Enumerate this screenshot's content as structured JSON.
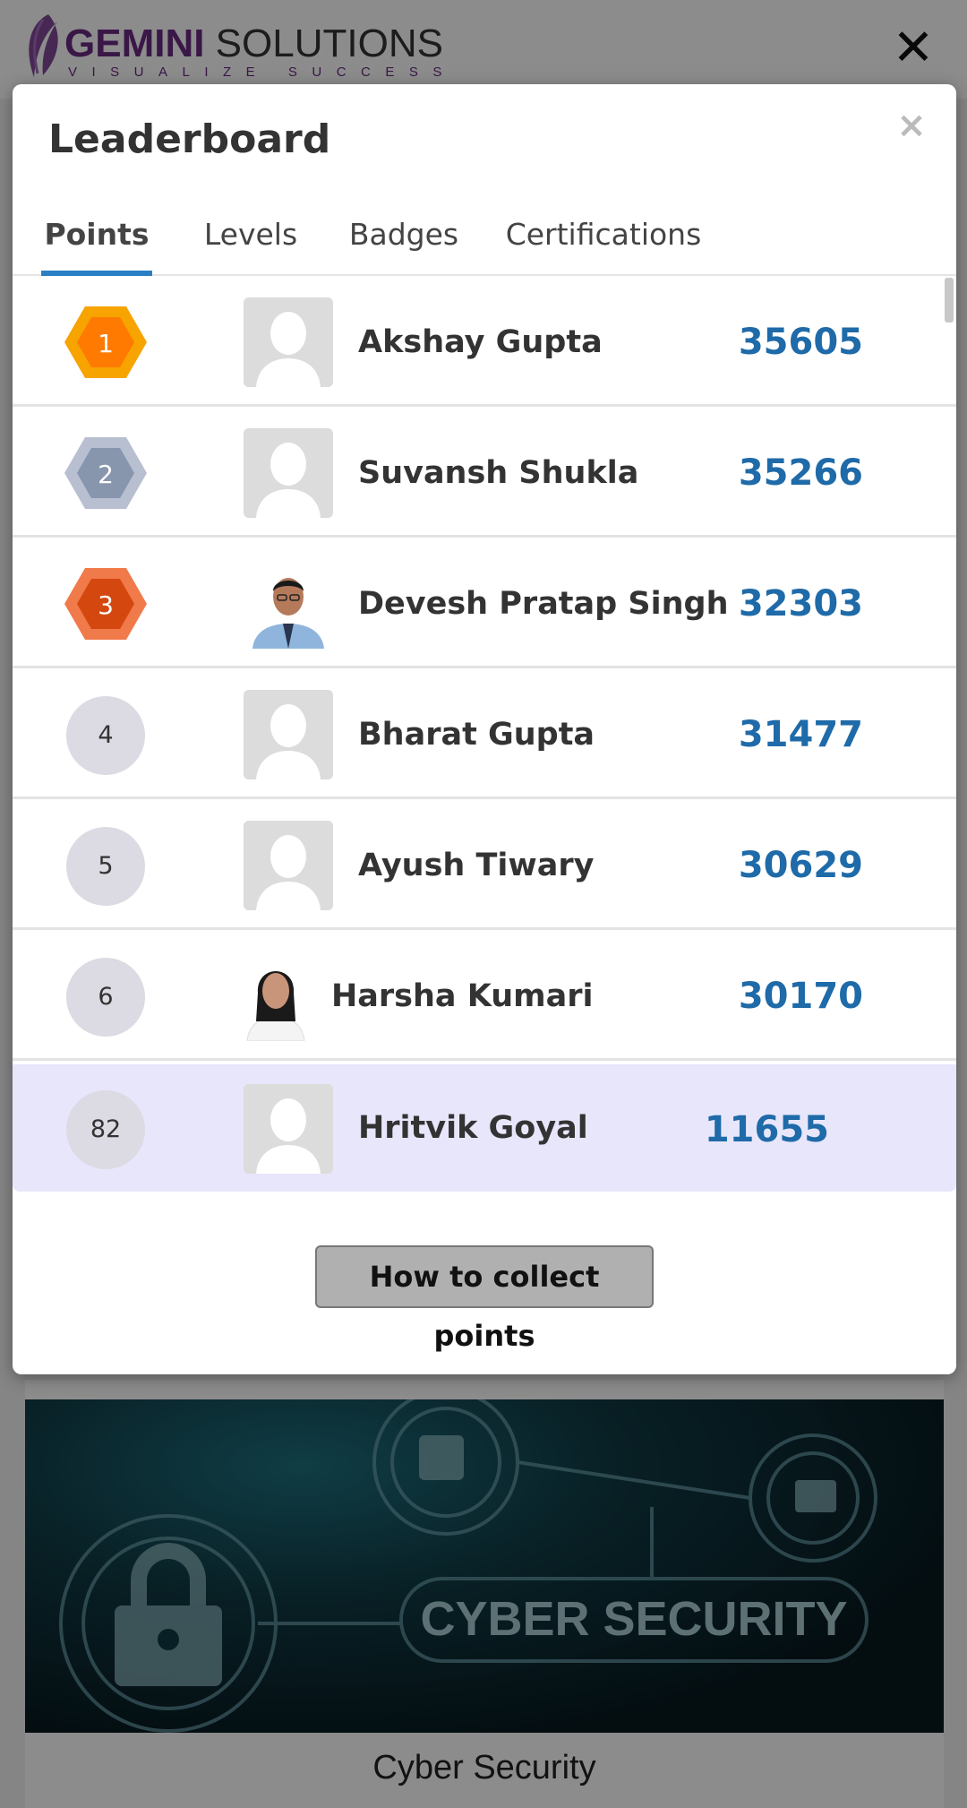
{
  "app": {
    "logo_main_gem": "GEMINI",
    "logo_main_rest": " SOLUTIONS",
    "logo_sub": "VISUALIZE SUCCESS",
    "close_icon": "close-icon",
    "close_glyph": "✕"
  },
  "background_card": {
    "image_text": "CYBER SECURITY",
    "title": "Cyber Security"
  },
  "modal": {
    "title": "Leaderboard",
    "close_glyph": "×",
    "tabs": [
      {
        "label": "Points",
        "active": true
      },
      {
        "label": "Levels",
        "active": false
      },
      {
        "label": "Badges",
        "active": false
      },
      {
        "label": "Certifications",
        "active": false
      }
    ],
    "rows": [
      {
        "rank": "1",
        "name": "Akshay Gupta",
        "points": "35605",
        "badge": "gold",
        "avatar": "placeholder"
      },
      {
        "rank": "2",
        "name": "Suvansh Shukla",
        "points": "35266",
        "badge": "silver",
        "avatar": "placeholder"
      },
      {
        "rank": "3",
        "name": "Devesh Pratap Singh",
        "points": "32303",
        "badge": "bronze",
        "avatar": "photo-male"
      },
      {
        "rank": "4",
        "name": "Bharat Gupta",
        "points": "31477",
        "badge": "plain",
        "avatar": "placeholder"
      },
      {
        "rank": "5",
        "name": "Ayush Tiwary",
        "points": "30629",
        "badge": "plain",
        "avatar": "placeholder"
      },
      {
        "rank": "6",
        "name": "Harsha Kumari",
        "points": "30170",
        "badge": "plain",
        "avatar": "photo-female"
      },
      {
        "rank": "82",
        "name": "Hritvik Goyal",
        "points": "11655",
        "badge": "plain",
        "avatar": "placeholder",
        "current_user": true
      }
    ],
    "collect_button": "How to collect points"
  },
  "colors": {
    "accent": "#2a7fc4",
    "points": "#1f6aa8",
    "current_user_row": "#e8e6fb",
    "gold": "#f7a300",
    "silver": "#9aa6b8",
    "bronze": "#e0561f",
    "brand": "#6b2a82"
  }
}
